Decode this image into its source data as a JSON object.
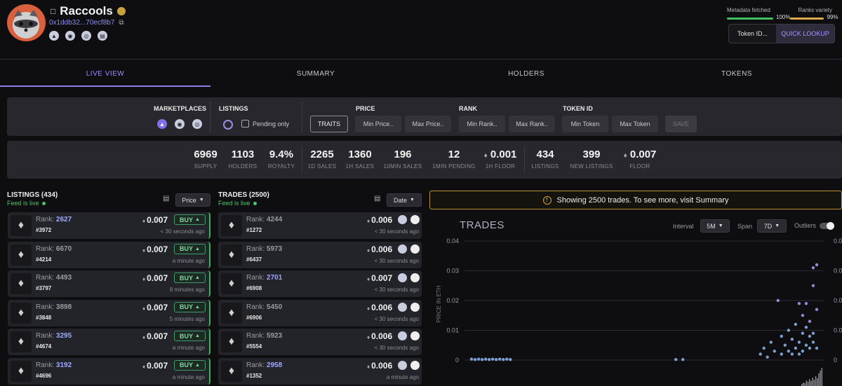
{
  "collection": {
    "name": "Raccools",
    "address": "0x1ddb32...70ecf8b7",
    "marketplace_icons": [
      "opensea-icon",
      "looksrare-icon",
      "x2y2-icon",
      "stats-icon"
    ]
  },
  "meta": {
    "metadata_label": "Metadata fetched",
    "metadata_value": "100%",
    "ranks_label": "Ranks variety",
    "ranks_value": "99%",
    "metadata_color": "#3fbf62",
    "ranks_color": "#d9a94a"
  },
  "lookup": {
    "token_placeholder": "Token ID...",
    "button": "QUICK LOOKUP"
  },
  "tabs": [
    "LIVE VIEW",
    "SUMMARY",
    "HOLDERS",
    "TOKENS"
  ],
  "filters": {
    "marketplaces_label": "MARKETPLACES",
    "listings_label": "LISTINGS",
    "pending_label": "Pending only",
    "price_label": "PRICE",
    "rank_label": "RANK",
    "tokenid_label": "TOKEN ID",
    "traits_button": "TRAITS",
    "min_price": "Min Price..",
    "max_price": "Max Price..",
    "min_rank": "Min Rank..",
    "max_rank": "Max Rank..",
    "min_token": "Min Token",
    "max_token": "Max Token",
    "save_button": "SAVE"
  },
  "stats": [
    {
      "value": "6969",
      "label": "SUPPLY"
    },
    {
      "value": "1103",
      "label": "HOLDERS"
    },
    {
      "value": "9.4%",
      "label": "ROYALTY"
    },
    {
      "value": "2265",
      "label": "1D SALES"
    },
    {
      "value": "1360",
      "label": "1H SALES"
    },
    {
      "value": "196",
      "label": "10MIN SALES"
    },
    {
      "value": "12",
      "label": "1MIN PENDING"
    },
    {
      "value": "0.001",
      "label": "1H FLOOR"
    },
    {
      "value": "434",
      "label": "LISTINGS"
    },
    {
      "value": "399",
      "label": "NEW LISTINGS"
    },
    {
      "value": "0.007",
      "label": "FLOOR"
    }
  ],
  "listings": {
    "title": "LISTINGS (434)",
    "feed": "Feed is live",
    "sort": "Price",
    "rank_prefix": "Rank:",
    "buy_label": "BUY",
    "items": [
      {
        "rank": "2627",
        "rank_highlight": true,
        "token": "#3972",
        "price": "0.007",
        "ago": "< 30 seconds ago"
      },
      {
        "rank": "6670",
        "rank_highlight": false,
        "token": "#4214",
        "price": "0.007",
        "ago": "a minute ago"
      },
      {
        "rank": "4493",
        "rank_highlight": false,
        "token": "#3797",
        "price": "0.007",
        "ago": "8 minutes ago"
      },
      {
        "rank": "3898",
        "rank_highlight": false,
        "token": "#3848",
        "price": "0.007",
        "ago": "5 minutes ago"
      },
      {
        "rank": "3295",
        "rank_highlight": true,
        "token": "#4674",
        "price": "0.007",
        "ago": "a minute ago"
      },
      {
        "rank": "3192",
        "rank_highlight": true,
        "token": "#4696",
        "price": "0.007",
        "ago": "a minute ago"
      }
    ]
  },
  "trades": {
    "title": "TRADES (2500)",
    "feed": "Feed is live",
    "sort": "Date",
    "rank_prefix": "Rank:",
    "items": [
      {
        "rank": "4244",
        "rank_highlight": false,
        "token": "#1272",
        "price": "0.006",
        "ago": "< 30 seconds ago"
      },
      {
        "rank": "5973",
        "rank_highlight": false,
        "token": "#6437",
        "price": "0.006",
        "ago": "< 30 seconds ago"
      },
      {
        "rank": "2701",
        "rank_highlight": true,
        "token": "#6908",
        "price": "0.007",
        "ago": "< 30 seconds ago"
      },
      {
        "rank": "5450",
        "rank_highlight": false,
        "token": "#6906",
        "price": "0.006",
        "ago": "< 30 seconds ago"
      },
      {
        "rank": "5923",
        "rank_highlight": false,
        "token": "#5554",
        "price": "0.006",
        "ago": "< 30 seconds ago"
      },
      {
        "rank": "2958",
        "rank_highlight": true,
        "token": "#1352",
        "price": "0.006",
        "ago": "a minute ago"
      }
    ]
  },
  "banner": "Showing 2500 trades. To see more, visit Summary",
  "chart": {
    "title": "TRADES",
    "interval_label": "Interval",
    "interval_value": "5M",
    "span_label": "Span",
    "span_value": "7D",
    "outliers_label": "Outliers",
    "y_ticks": [
      "0.04",
      "0.03",
      "0.02",
      "0.01",
      "0"
    ],
    "ylabel": "PRICE IN ETH"
  },
  "chart_data": {
    "type": "scatter",
    "title": "TRADES",
    "ylabel": "PRICE IN ETH",
    "ylim": [
      0,
      0.04
    ],
    "y_ticks": [
      0,
      0.01,
      0.02,
      0.03,
      0.04
    ],
    "series": [
      {
        "points_x_fraction": [
          0.02,
          0.03,
          0.04,
          0.05,
          0.06,
          0.07,
          0.08,
          0.09,
          0.1,
          0.11,
          0.12,
          0.13,
          0.6,
          0.62,
          0.84,
          0.85,
          0.86,
          0.87,
          0.88,
          0.89,
          0.9,
          0.9,
          0.91,
          0.92,
          0.92,
          0.93,
          0.93,
          0.94,
          0.94,
          0.95,
          0.95,
          0.95,
          0.96,
          0.96,
          0.96,
          0.97,
          0.97,
          0.97,
          0.98,
          0.98,
          0.98,
          0.99,
          0.99,
          0.99,
          0.99,
          1.0,
          1.0,
          1.0
        ],
        "y": [
          0.0003,
          0.0002,
          0.0003,
          0.0002,
          0.0003,
          0.0002,
          0.0003,
          0.0002,
          0.0003,
          0.0002,
          0.0003,
          0.0002,
          0.0002,
          0.0002,
          0.002,
          0.004,
          0.001,
          0.006,
          0.003,
          0.02,
          0.008,
          0.002,
          0.005,
          0.003,
          0.01,
          0.007,
          0.002,
          0.012,
          0.004,
          0.019,
          0.006,
          0.002,
          0.009,
          0.015,
          0.003,
          0.005,
          0.019,
          0.011,
          0.008,
          0.004,
          0.013,
          0.031,
          0.025,
          0.009,
          0.006,
          0.032,
          0.017,
          0.004
        ]
      }
    ]
  }
}
